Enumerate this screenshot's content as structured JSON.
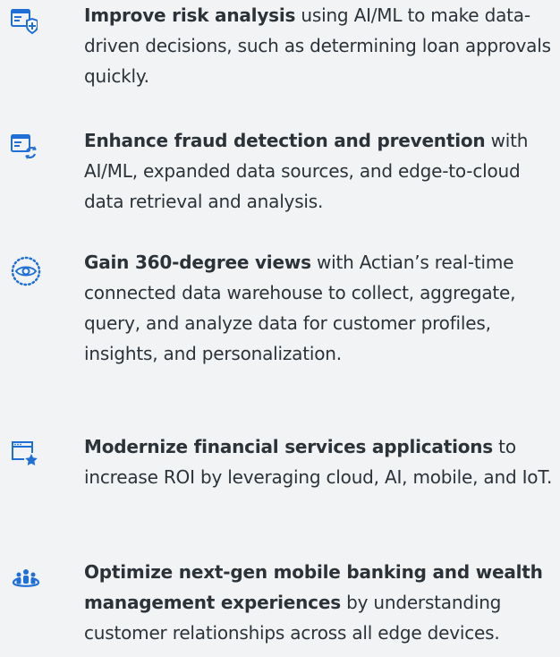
{
  "accent_color": "#1f6fd6",
  "items": [
    {
      "icon": "form-shield-icon",
      "lead": "Improve risk analysis",
      "rest": " using AI/ML to make data-driven decisions, such as determining loan approvals quickly."
    },
    {
      "icon": "form-refresh-icon",
      "lead": "Enhance fraud detection and prevention",
      "rest": " with AI/ML, expanded data sources, and edge-to-cloud data retrieval and analysis."
    },
    {
      "icon": "eye-icon",
      "lead": "Gain 360-degree views",
      "rest": " with Actian’s real-time connected data warehouse to collect, aggregate, query, and analyze data for customer profiles, insights, and personalization."
    },
    {
      "icon": "browser-star-icon",
      "lead": "Modernize financial services applications",
      "rest": " to increase ROI by leveraging cloud, AI, mobile, and IoT."
    },
    {
      "icon": "people-group-icon",
      "lead": "Optimize next-gen mobile banking and wealth management experiences",
      "rest": " by understanding customer relationships across all edge devices."
    }
  ]
}
